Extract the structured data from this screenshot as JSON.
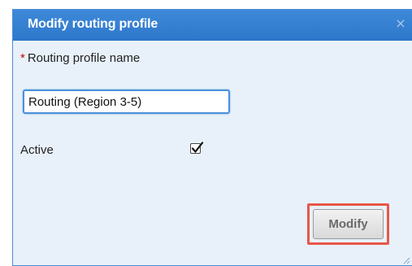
{
  "dialog": {
    "title": "Modify routing profile",
    "close_icon": "close-icon",
    "name_field": {
      "label": "Routing profile name",
      "required_marker": "*",
      "value": "Routing (Region 3-5)"
    },
    "active_field": {
      "label": "Active",
      "checked": true
    },
    "modify_button": {
      "label": "Modify",
      "highlighted": true,
      "highlight_color": "#e8574a"
    }
  },
  "colors": {
    "title_bar": "#2e78cc",
    "dialog_background": "#e8f1fa",
    "input_border": "#4a90d9"
  }
}
